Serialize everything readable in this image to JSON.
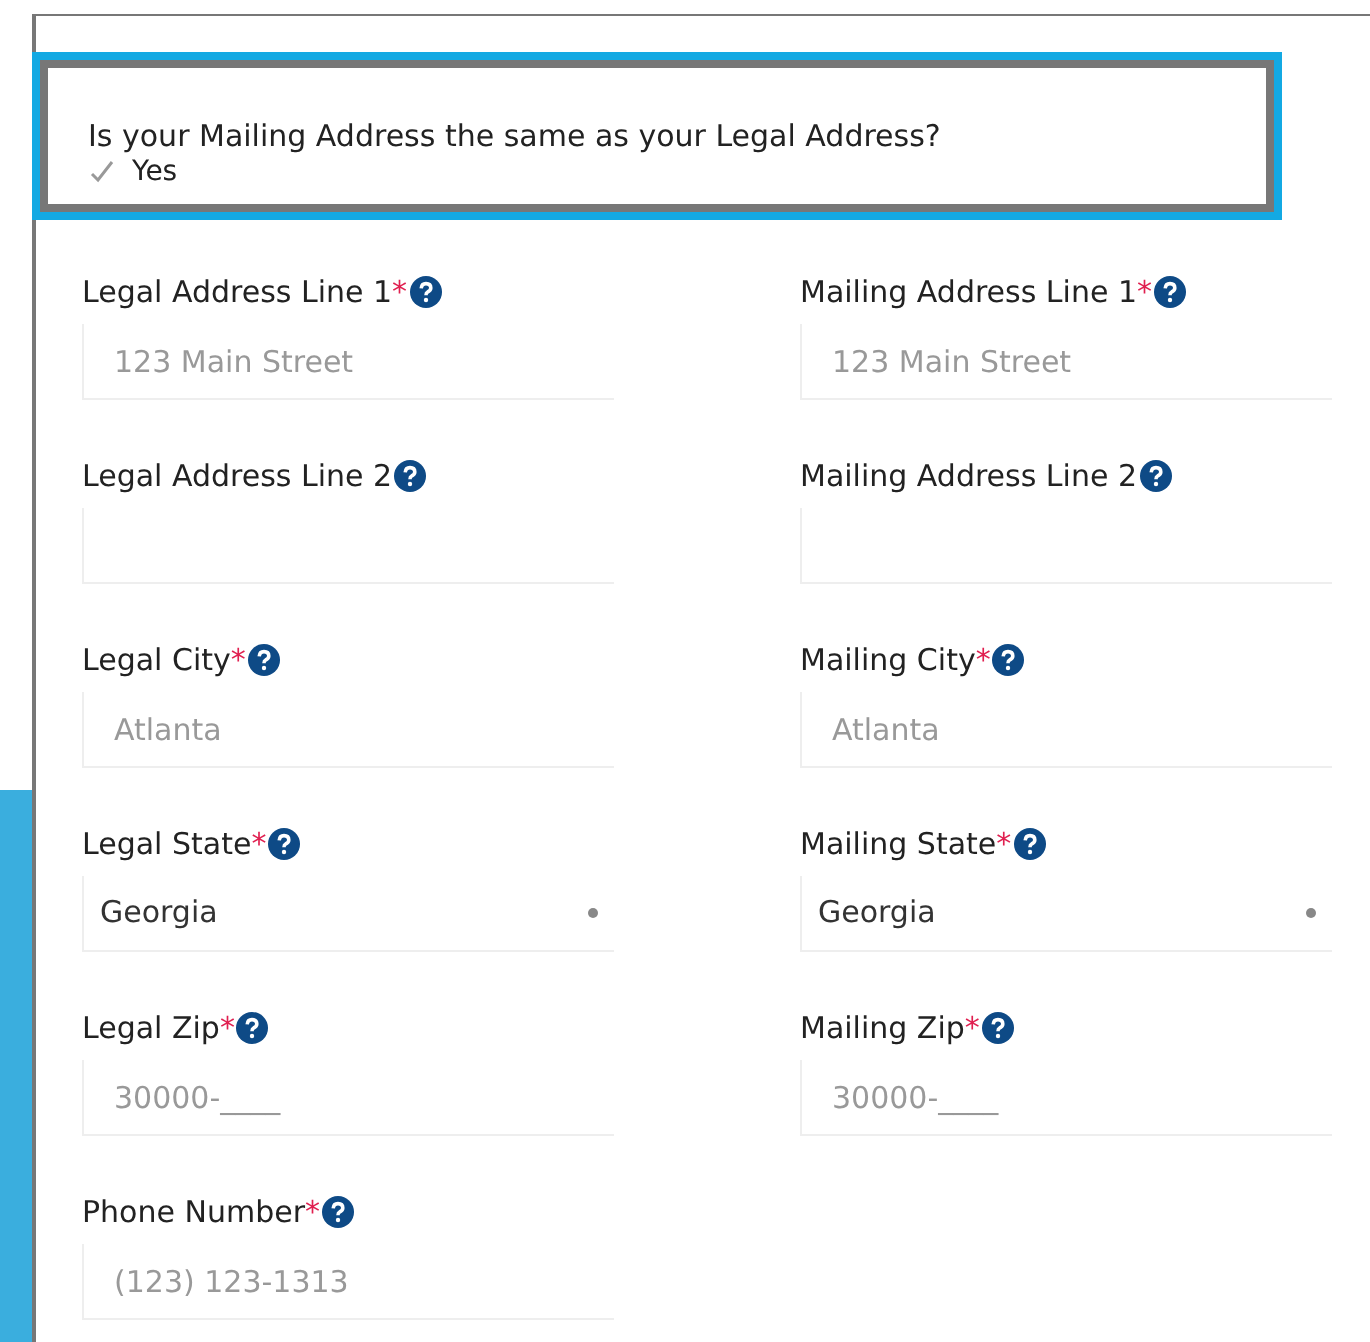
{
  "same_address": {
    "question": "Is your Mailing Address the same as your Legal Address?",
    "option": {
      "label": "Yes",
      "checked": true
    }
  },
  "fields": [
    {
      "label": "Legal Address Line 1",
      "required_mark": "*",
      "kind": "text",
      "placeholder": "123 Main Street"
    },
    {
      "label": "Mailing Address Line 1",
      "required_mark": "*",
      "kind": "text",
      "placeholder": "123 Main Street"
    },
    {
      "label": "Legal Address Line 2",
      "kind": "text"
    },
    {
      "label": "Mailing Address Line 2",
      "kind": "text"
    },
    {
      "label": "Legal City",
      "required_mark": "*",
      "kind": "text",
      "placeholder": "Atlanta"
    },
    {
      "label": "Mailing City",
      "required_mark": "*",
      "kind": "text",
      "placeholder": "Atlanta"
    },
    {
      "label": "Legal State",
      "required_mark": "*",
      "kind": "select",
      "value": "Georgia"
    },
    {
      "label": "Mailing State",
      "required_mark": "*",
      "kind": "select",
      "value": "Georgia"
    },
    {
      "label": "Legal Zip",
      "required_mark": "*",
      "kind": "text",
      "placeholder": "30000-____"
    },
    {
      "label": "Mailing Zip",
      "required_mark": "*",
      "kind": "text",
      "placeholder": "30000-____"
    },
    {
      "label": "Phone Number",
      "required_mark": "*",
      "kind": "text",
      "placeholder": "(123) 123-1313"
    }
  ]
}
